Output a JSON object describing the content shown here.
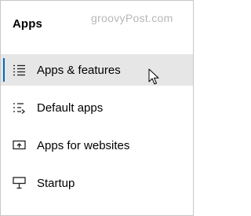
{
  "header": {
    "title": "Apps",
    "watermark": "groovyPost.com"
  },
  "nav": {
    "items": [
      {
        "label": "Apps & features",
        "icon": "apps-features-list-icon",
        "selected": true
      },
      {
        "label": "Default apps",
        "icon": "default-apps-icon",
        "selected": false
      },
      {
        "label": "Apps for websites",
        "icon": "apps-for-websites-icon",
        "selected": false
      },
      {
        "label": "Startup",
        "icon": "startup-icon",
        "selected": false
      }
    ]
  },
  "colors": {
    "selected_background": "#e6e6e6",
    "accent": "#0067c0",
    "watermark": "#b7b7b7"
  },
  "cursor": {
    "icon": "mouse-pointer-icon"
  }
}
